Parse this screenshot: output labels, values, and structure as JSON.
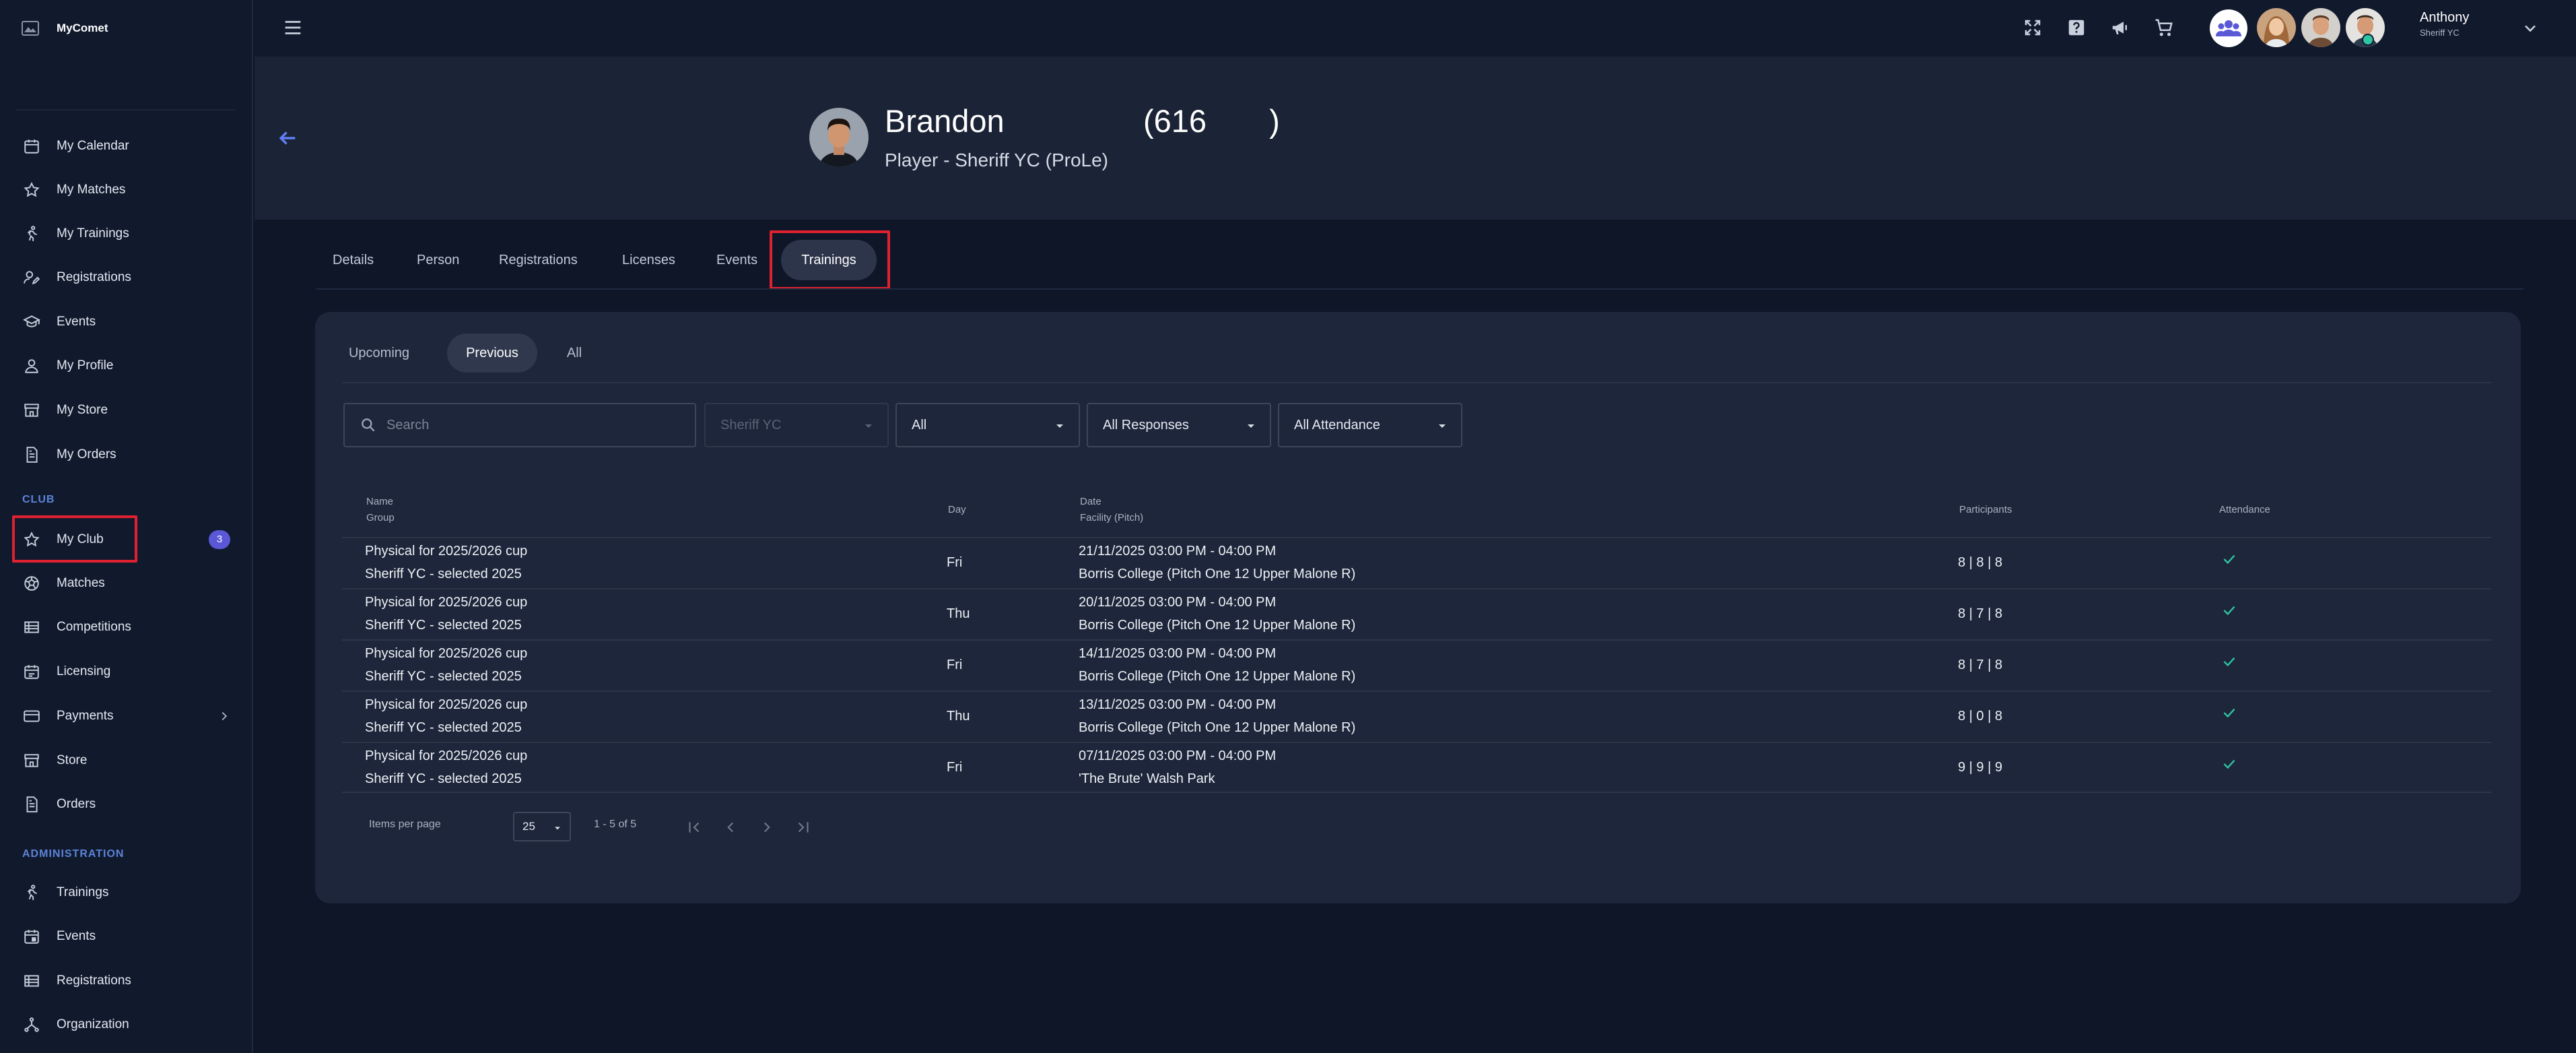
{
  "app": {
    "name": "MyComet"
  },
  "sidebar": {
    "items": [
      {
        "label": "My Calendar",
        "icon": "calendar-icon"
      },
      {
        "label": "My Matches",
        "icon": "star-icon"
      },
      {
        "label": "My Trainings",
        "icon": "running-icon"
      },
      {
        "label": "Registrations",
        "icon": "user-edit-icon"
      },
      {
        "label": "Events",
        "icon": "graduation-cap-icon"
      },
      {
        "label": "My Profile",
        "icon": "person-icon"
      },
      {
        "label": "My Store",
        "icon": "store-icon"
      },
      {
        "label": "My Orders",
        "icon": "receipt-icon"
      }
    ],
    "club_section": "CLUB",
    "club_items": [
      {
        "label": "My Club",
        "icon": "star-icon",
        "badge": "3"
      },
      {
        "label": "Matches",
        "icon": "soccer-ball-icon"
      },
      {
        "label": "Competitions",
        "icon": "list-icon"
      },
      {
        "label": "Licensing",
        "icon": "calendar-check-icon"
      },
      {
        "label": "Payments",
        "icon": "credit-card-icon"
      },
      {
        "label": "Store",
        "icon": "store-icon"
      },
      {
        "label": "Orders",
        "icon": "receipt-icon"
      }
    ],
    "admin_section": "ADMINISTRATION",
    "admin_items": [
      {
        "label": "Trainings",
        "icon": "running-icon"
      },
      {
        "label": "Events",
        "icon": "calendar-event-icon"
      },
      {
        "label": "Registrations",
        "icon": "list-icon"
      },
      {
        "label": "Organization",
        "icon": "hierarchy-icon"
      }
    ]
  },
  "user": {
    "name": "Anthony",
    "club": "Sheriff YC"
  },
  "header": {
    "first_name": "Brandon",
    "id_open": "(616",
    "id_close": ")",
    "role": "Player - Sheriff YC (ProLe)"
  },
  "tabs": [
    "Details",
    "Person",
    "Registrations",
    "Licenses",
    "Events",
    "Trainings"
  ],
  "subtabs": [
    "Upcoming",
    "Previous",
    "All"
  ],
  "filters": {
    "search_placeholder": "Search",
    "club": "Sheriff YC",
    "type": "All",
    "responses": "All Responses",
    "attendance": "All Attendance"
  },
  "table": {
    "headers": {
      "name": "Name",
      "group": "Group",
      "day": "Day",
      "date": "Date",
      "facility": "Facility (Pitch)",
      "participants": "Participants",
      "attendance": "Attendance"
    },
    "rows": [
      {
        "name": "Physical for 2025/2026 cup",
        "group": "Sheriff YC - selected 2025",
        "day": "Fri",
        "date": "21/11/2025 03:00 PM - 04:00 PM",
        "facility": "Borris College (Pitch One 12 Upper Malone R)",
        "participants": "8 | 8 | 8"
      },
      {
        "name": "Physical for 2025/2026 cup",
        "group": "Sheriff YC - selected 2025",
        "day": "Thu",
        "date": "20/11/2025 03:00 PM - 04:00 PM",
        "facility": "Borris College (Pitch One 12 Upper Malone R)",
        "participants": "8 | 7 | 8"
      },
      {
        "name": "Physical for 2025/2026 cup",
        "group": "Sheriff YC - selected 2025",
        "day": "Fri",
        "date": "14/11/2025 03:00 PM - 04:00 PM",
        "facility": "Borris College (Pitch One 12 Upper Malone R)",
        "participants": "8 | 7 | 8"
      },
      {
        "name": "Physical for 2025/2026 cup",
        "group": "Sheriff YC - selected 2025",
        "day": "Thu",
        "date": "13/11/2025 03:00 PM - 04:00 PM",
        "facility": "Borris College (Pitch One 12 Upper Malone R)",
        "participants": "8 | 0 | 8"
      },
      {
        "name": "Physical for 2025/2026 cup",
        "group": "Sheriff YC - selected 2025",
        "day": "Fri",
        "date": "07/11/2025 03:00 PM - 04:00 PM",
        "facility": "'The Brute' Walsh Park",
        "participants": "9 | 9 | 9"
      }
    ]
  },
  "pagination": {
    "items_label": "Items per page",
    "page_size": "25",
    "range": "1 - 5 of 5"
  },
  "colors": {
    "accent": "#5f7ef2",
    "badge": "#5a58d6",
    "highlight": "#e0212f",
    "check": "#2fc5a3",
    "section_title": "#5c83d8"
  }
}
